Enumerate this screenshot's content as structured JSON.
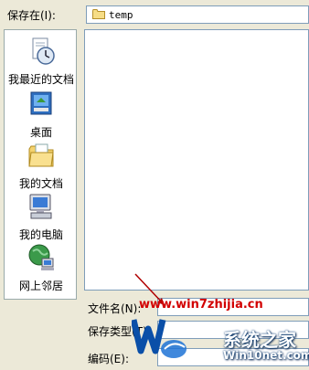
{
  "dialog": {
    "save_in_label": "保存在(I):",
    "save_in_value": "temp",
    "places": [
      {
        "label": "我最近的文档",
        "icon": "recent-documents-icon"
      },
      {
        "label": "桌面",
        "icon": "desktop-icon"
      },
      {
        "label": "我的文档",
        "icon": "my-documents-icon"
      },
      {
        "label": "我的电脑",
        "icon": "my-computer-icon"
      },
      {
        "label": "网上邻居",
        "icon": "network-places-icon"
      }
    ],
    "filename_label": "文件名(N):",
    "filename_value": "",
    "savetype_label": "保存类型(T):",
    "savetype_value": "",
    "encoding_label": "编码(E):",
    "encoding_value": ""
  },
  "watermark": {
    "url": "www.win7zhijia.cn",
    "brand": "系统之家",
    "site": "Win10net.com"
  },
  "colors": {
    "dialog_bg": "#ece9d8",
    "field_border": "#7f9db9",
    "watermark_red": "#d20000"
  }
}
